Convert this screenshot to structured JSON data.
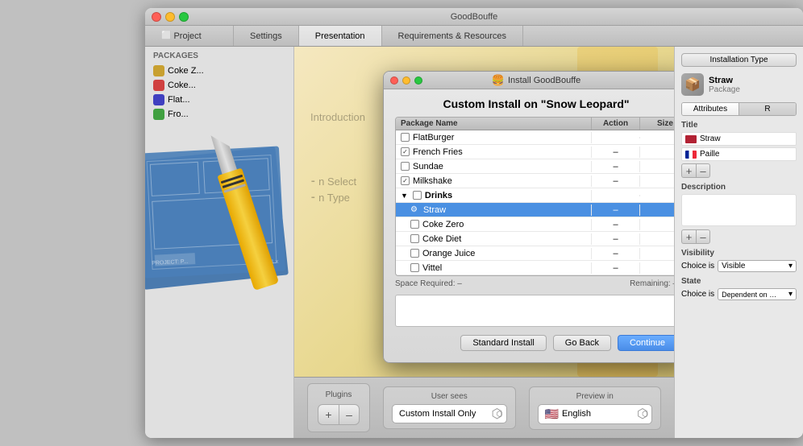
{
  "window": {
    "title": "GoodBouffe",
    "tabs": [
      {
        "label": "Project",
        "active": false
      },
      {
        "label": "Settings",
        "active": false
      },
      {
        "label": "Presentation",
        "active": true
      },
      {
        "label": "Requirements & Resources",
        "active": false
      }
    ]
  },
  "packages": {
    "header": "PACKAGES",
    "items": [
      {
        "name": "Coke Z..."
      },
      {
        "name": "Coke..."
      },
      {
        "name": "Flat..."
      },
      {
        "name": "Fro..."
      }
    ]
  },
  "install_dialog": {
    "title": "Install GoodBouffe",
    "heading": "Custom Install on \"Snow Leopard\"",
    "table": {
      "columns": [
        "Package Name",
        "Action",
        "Size"
      ],
      "rows": [
        {
          "name": "FlatBurger",
          "checked": false,
          "indent": false,
          "group": false,
          "action": "",
          "size": "",
          "selected": false
        },
        {
          "name": "French Fries",
          "checked": true,
          "indent": false,
          "group": false,
          "action": "–",
          "size": "",
          "selected": false
        },
        {
          "name": "Sundae",
          "checked": false,
          "indent": false,
          "group": false,
          "action": "–",
          "size": "",
          "selected": false
        },
        {
          "name": "Milkshake",
          "checked": true,
          "indent": false,
          "group": false,
          "action": "–",
          "size": "",
          "selected": false
        },
        {
          "name": "Drinks",
          "checked": false,
          "indent": false,
          "group": true,
          "action": "",
          "size": "",
          "selected": false
        },
        {
          "name": "Straw",
          "checked": false,
          "indent": true,
          "group": false,
          "action": "–",
          "size": "",
          "selected": true
        },
        {
          "name": "Coke Zero",
          "checked": false,
          "indent": true,
          "group": false,
          "action": "–",
          "size": "",
          "selected": false
        },
        {
          "name": "Coke Diet",
          "checked": false,
          "indent": true,
          "group": false,
          "action": "–",
          "size": "",
          "selected": false
        },
        {
          "name": "Orange Juice",
          "checked": false,
          "indent": true,
          "group": false,
          "action": "–",
          "size": "",
          "selected": false
        },
        {
          "name": "Vittel",
          "checked": false,
          "indent": true,
          "group": false,
          "action": "–",
          "size": "",
          "selected": false
        }
      ]
    },
    "space_required": "Space Required:  –",
    "remaining": "Remaining:  –",
    "buttons": {
      "standard": "Standard Install",
      "back": "Go Back",
      "continue": "Continue"
    }
  },
  "bottom_toolbar": {
    "plugins_label": "Plugins",
    "plus_label": "+",
    "minus_label": "–",
    "user_sees_label": "User sees",
    "user_sees_value": "Custom Install Only",
    "preview_in_label": "Preview in",
    "preview_in_value": "English"
  },
  "right_panel": {
    "install_type_btn": "Installation Type",
    "pkg_name": "Straw",
    "pkg_type": "Package",
    "tabs": [
      "Attributes",
      "R"
    ],
    "title_label": "Title",
    "title_rows": [
      {
        "flag": "en",
        "value": "Straw"
      },
      {
        "flag": "fr",
        "value": "Paille"
      }
    ],
    "description_label": "Description",
    "visibility_label": "Visibility",
    "visibility_choice": "Choice is",
    "visibility_value": "Visible",
    "state_label": "State",
    "state_choice": "Choice is",
    "state_value": "Dependent on Oth..."
  }
}
